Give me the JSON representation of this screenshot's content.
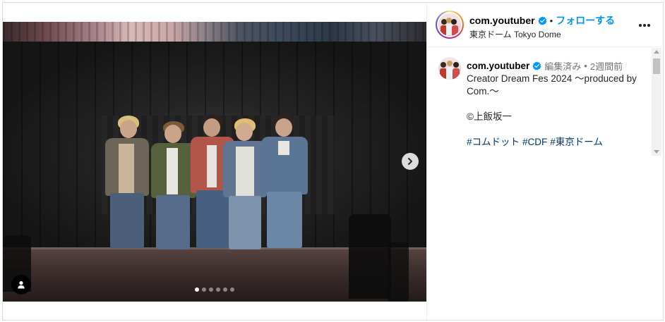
{
  "post": {
    "media": {
      "alt_semantic": "stage-photo",
      "carousel_dot_count": 6,
      "carousel_active_index": 0
    }
  },
  "header": {
    "username": "com.youtuber",
    "verified": true,
    "separator": "•",
    "follow_label": "フォローする",
    "location": "東京ドーム Tokyo Dome",
    "more_icon": "more-horizontal-icon"
  },
  "caption": {
    "username": "com.youtuber",
    "edited_label": "編集済み",
    "separator": "•",
    "time": "2週間前",
    "line1": "Creator Dream Fes 2024 ～produced by Com.～",
    "credit": "©上飯坂一",
    "hashtags": [
      "#コムドット",
      "#CDF",
      "#東京ドーム"
    ]
  },
  "colors": {
    "accent": "#0095f6",
    "hashtag": "#00376b",
    "muted_text": "#737373",
    "border": "#dbdbdb"
  }
}
